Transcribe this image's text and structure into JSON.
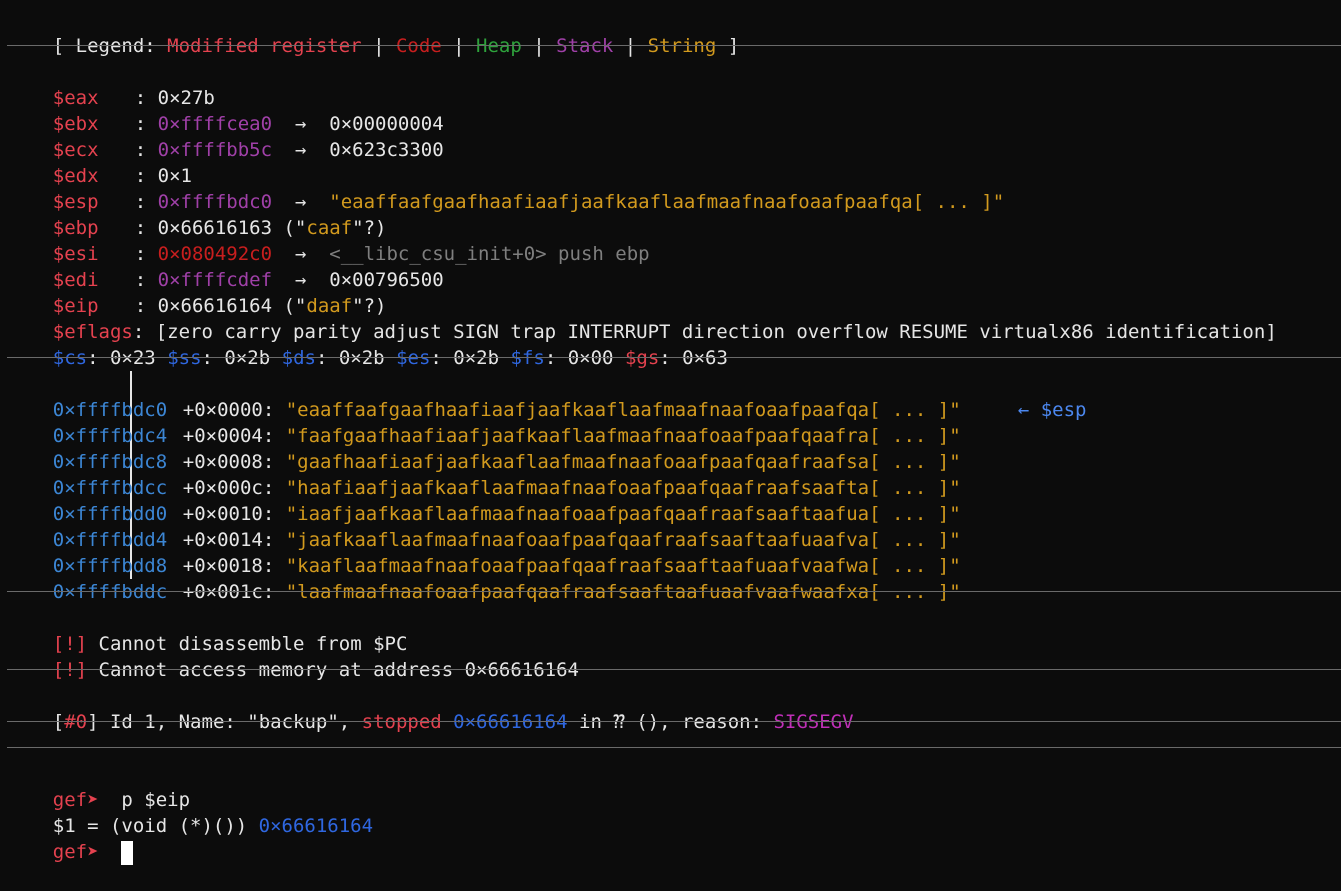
{
  "legend": {
    "open": "[ Legend: ",
    "items": [
      {
        "label": "Modified register",
        "color": "#e5424f"
      },
      {
        "label": "Code",
        "color": "#c81e1e"
      },
      {
        "label": "Heap",
        "color": "#2ea33c"
      },
      {
        "label": "Stack",
        "color": "#a040a8"
      },
      {
        "label": "String",
        "color": "#d29a1e"
      }
    ],
    "sep": " | ",
    "close": " ]"
  },
  "registers": [
    {
      "name": "$eax",
      "value": "0×27b"
    },
    {
      "name": "$ebx",
      "value": "0×ffffcea0",
      "arrow": "→",
      "deref": "0×00000004"
    },
    {
      "name": "$ecx",
      "value": "0×ffffbb5c",
      "arrow": "→",
      "deref": "0×623c3300"
    },
    {
      "name": "$edx",
      "value": "0×1"
    },
    {
      "name": "$esp",
      "value": "0×ffffbdc0",
      "arrow": "→",
      "deref": "\"eaaffaafgaafhaafiaafjaafkaaflaafmaafnaafoaafpaafqa[ ... ]\""
    },
    {
      "name": "$ebp",
      "value": "0×66616163",
      "str_open": " (\"",
      "str": "caaf",
      "str_close": "\"?)"
    },
    {
      "name": "$esi",
      "value": "0×080492c0",
      "arrow": "→",
      "deref": "<__libc_csu_init+0> push ebp"
    },
    {
      "name": "$edi",
      "value": "0×ffffcdef",
      "arrow": "→",
      "deref": "0×00796500"
    },
    {
      "name": "$eip",
      "value": "0×66616164",
      "str_open": " (\"",
      "str": "daaf",
      "str_close": "\"?)"
    }
  ],
  "eflags": {
    "name": "$eflags",
    "value": "[zero carry parity adjust SIGN trap INTERRUPT direction overflow RESUME virtualx86 identification]"
  },
  "segments": [
    {
      "name": "$cs",
      "value": "0×23"
    },
    {
      "name": "$ss",
      "value": "0×2b"
    },
    {
      "name": "$ds",
      "value": "0×2b"
    },
    {
      "name": "$es",
      "value": "0×2b"
    },
    {
      "name": "$fs",
      "value": "0×00"
    },
    {
      "name": "$gs",
      "value": "0×63"
    }
  ],
  "stack": [
    {
      "addr": "0×ffffbdc0",
      "offset": "+0×0000:",
      "value": "\"eaaffaafgaafhaafiaafjaafkaaflaafmaafnaafoaafpaafqa[ ... ]\"",
      "marker": "← $esp"
    },
    {
      "addr": "0×ffffbdc4",
      "offset": "+0×0004:",
      "value": "\"faafgaafhaafiaafjaafkaaflaafmaafnaafoaafpaafqaafra[ ... ]\""
    },
    {
      "addr": "0×ffffbdc8",
      "offset": "+0×0008:",
      "value": "\"gaafhaafiaafjaafkaaflaafmaafnaafoaafpaafqaafraafsa[ ... ]\""
    },
    {
      "addr": "0×ffffbdcc",
      "offset": "+0×000c:",
      "value": "\"haafiaafjaafkaaflaafmaafnaafoaafpaafqaafraafsaafta[ ... ]\""
    },
    {
      "addr": "0×ffffbdd0",
      "offset": "+0×0010:",
      "value": "\"iaafjaafkaaflaafmaafnaafoaafpaafqaafraafsaaftaafua[ ... ]\""
    },
    {
      "addr": "0×ffffbdd4",
      "offset": "+0×0014:",
      "value": "\"jaafkaaflaafmaafnaafoaafpaafqaafraafsaaftaafuaafva[ ... ]\""
    },
    {
      "addr": "0×ffffbdd8",
      "offset": "+0×0018:",
      "value": "\"kaaflaafmaafnaafoaafpaafqaafraafsaaftaafuaafvaafwa[ ... ]\""
    },
    {
      "addr": "0×ffffbddc",
      "offset": "+0×001c:",
      "value": "\"laafmaafnaafoaafpaafqaafraafsaaftaafuaafvaafwaafxa[ ... ]\""
    }
  ],
  "errors": [
    {
      "tag": "[!]",
      "text": " Cannot disassemble from $PC"
    },
    {
      "tag": "[!]",
      "text": " Cannot access memory at address 0×66616164"
    }
  ],
  "thread": {
    "open": "[",
    "id": "#0",
    "mid": "] Id 1, Name: \"backup\", ",
    "stopped": "stopped",
    "addr": " 0×66616164",
    "in": " in ⁇ (), reason: ",
    "reason": "SIGSEGV"
  },
  "console": {
    "prompt": "gef➤",
    "command": "  p $eip",
    "result_text": "$1 = (void (*)()) ",
    "result_value": "0×66616164"
  }
}
